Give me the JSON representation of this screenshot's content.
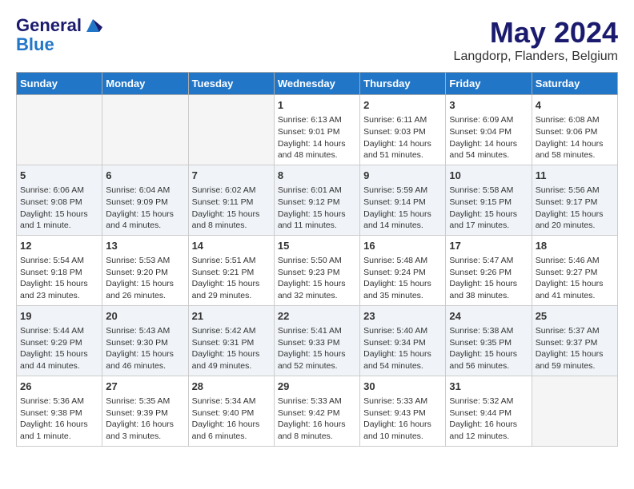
{
  "header": {
    "logo_line1": "General",
    "logo_line2": "Blue",
    "month_title": "May 2024",
    "location": "Langdorp, Flanders, Belgium"
  },
  "days_header": [
    "Sunday",
    "Monday",
    "Tuesday",
    "Wednesday",
    "Thursday",
    "Friday",
    "Saturday"
  ],
  "weeks": [
    [
      {
        "num": "",
        "info": ""
      },
      {
        "num": "",
        "info": ""
      },
      {
        "num": "",
        "info": ""
      },
      {
        "num": "1",
        "info": "Sunrise: 6:13 AM\nSunset: 9:01 PM\nDaylight: 14 hours and 48 minutes."
      },
      {
        "num": "2",
        "info": "Sunrise: 6:11 AM\nSunset: 9:03 PM\nDaylight: 14 hours and 51 minutes."
      },
      {
        "num": "3",
        "info": "Sunrise: 6:09 AM\nSunset: 9:04 PM\nDaylight: 14 hours and 54 minutes."
      },
      {
        "num": "4",
        "info": "Sunrise: 6:08 AM\nSunset: 9:06 PM\nDaylight: 14 hours and 58 minutes."
      }
    ],
    [
      {
        "num": "5",
        "info": "Sunrise: 6:06 AM\nSunset: 9:08 PM\nDaylight: 15 hours and 1 minute."
      },
      {
        "num": "6",
        "info": "Sunrise: 6:04 AM\nSunset: 9:09 PM\nDaylight: 15 hours and 4 minutes."
      },
      {
        "num": "7",
        "info": "Sunrise: 6:02 AM\nSunset: 9:11 PM\nDaylight: 15 hours and 8 minutes."
      },
      {
        "num": "8",
        "info": "Sunrise: 6:01 AM\nSunset: 9:12 PM\nDaylight: 15 hours and 11 minutes."
      },
      {
        "num": "9",
        "info": "Sunrise: 5:59 AM\nSunset: 9:14 PM\nDaylight: 15 hours and 14 minutes."
      },
      {
        "num": "10",
        "info": "Sunrise: 5:58 AM\nSunset: 9:15 PM\nDaylight: 15 hours and 17 minutes."
      },
      {
        "num": "11",
        "info": "Sunrise: 5:56 AM\nSunset: 9:17 PM\nDaylight: 15 hours and 20 minutes."
      }
    ],
    [
      {
        "num": "12",
        "info": "Sunrise: 5:54 AM\nSunset: 9:18 PM\nDaylight: 15 hours and 23 minutes."
      },
      {
        "num": "13",
        "info": "Sunrise: 5:53 AM\nSunset: 9:20 PM\nDaylight: 15 hours and 26 minutes."
      },
      {
        "num": "14",
        "info": "Sunrise: 5:51 AM\nSunset: 9:21 PM\nDaylight: 15 hours and 29 minutes."
      },
      {
        "num": "15",
        "info": "Sunrise: 5:50 AM\nSunset: 9:23 PM\nDaylight: 15 hours and 32 minutes."
      },
      {
        "num": "16",
        "info": "Sunrise: 5:48 AM\nSunset: 9:24 PM\nDaylight: 15 hours and 35 minutes."
      },
      {
        "num": "17",
        "info": "Sunrise: 5:47 AM\nSunset: 9:26 PM\nDaylight: 15 hours and 38 minutes."
      },
      {
        "num": "18",
        "info": "Sunrise: 5:46 AM\nSunset: 9:27 PM\nDaylight: 15 hours and 41 minutes."
      }
    ],
    [
      {
        "num": "19",
        "info": "Sunrise: 5:44 AM\nSunset: 9:29 PM\nDaylight: 15 hours and 44 minutes."
      },
      {
        "num": "20",
        "info": "Sunrise: 5:43 AM\nSunset: 9:30 PM\nDaylight: 15 hours and 46 minutes."
      },
      {
        "num": "21",
        "info": "Sunrise: 5:42 AM\nSunset: 9:31 PM\nDaylight: 15 hours and 49 minutes."
      },
      {
        "num": "22",
        "info": "Sunrise: 5:41 AM\nSunset: 9:33 PM\nDaylight: 15 hours and 52 minutes."
      },
      {
        "num": "23",
        "info": "Sunrise: 5:40 AM\nSunset: 9:34 PM\nDaylight: 15 hours and 54 minutes."
      },
      {
        "num": "24",
        "info": "Sunrise: 5:38 AM\nSunset: 9:35 PM\nDaylight: 15 hours and 56 minutes."
      },
      {
        "num": "25",
        "info": "Sunrise: 5:37 AM\nSunset: 9:37 PM\nDaylight: 15 hours and 59 minutes."
      }
    ],
    [
      {
        "num": "26",
        "info": "Sunrise: 5:36 AM\nSunset: 9:38 PM\nDaylight: 16 hours and 1 minute."
      },
      {
        "num": "27",
        "info": "Sunrise: 5:35 AM\nSunset: 9:39 PM\nDaylight: 16 hours and 3 minutes."
      },
      {
        "num": "28",
        "info": "Sunrise: 5:34 AM\nSunset: 9:40 PM\nDaylight: 16 hours and 6 minutes."
      },
      {
        "num": "29",
        "info": "Sunrise: 5:33 AM\nSunset: 9:42 PM\nDaylight: 16 hours and 8 minutes."
      },
      {
        "num": "30",
        "info": "Sunrise: 5:33 AM\nSunset: 9:43 PM\nDaylight: 16 hours and 10 minutes."
      },
      {
        "num": "31",
        "info": "Sunrise: 5:32 AM\nSunset: 9:44 PM\nDaylight: 16 hours and 12 minutes."
      },
      {
        "num": "",
        "info": ""
      }
    ]
  ]
}
